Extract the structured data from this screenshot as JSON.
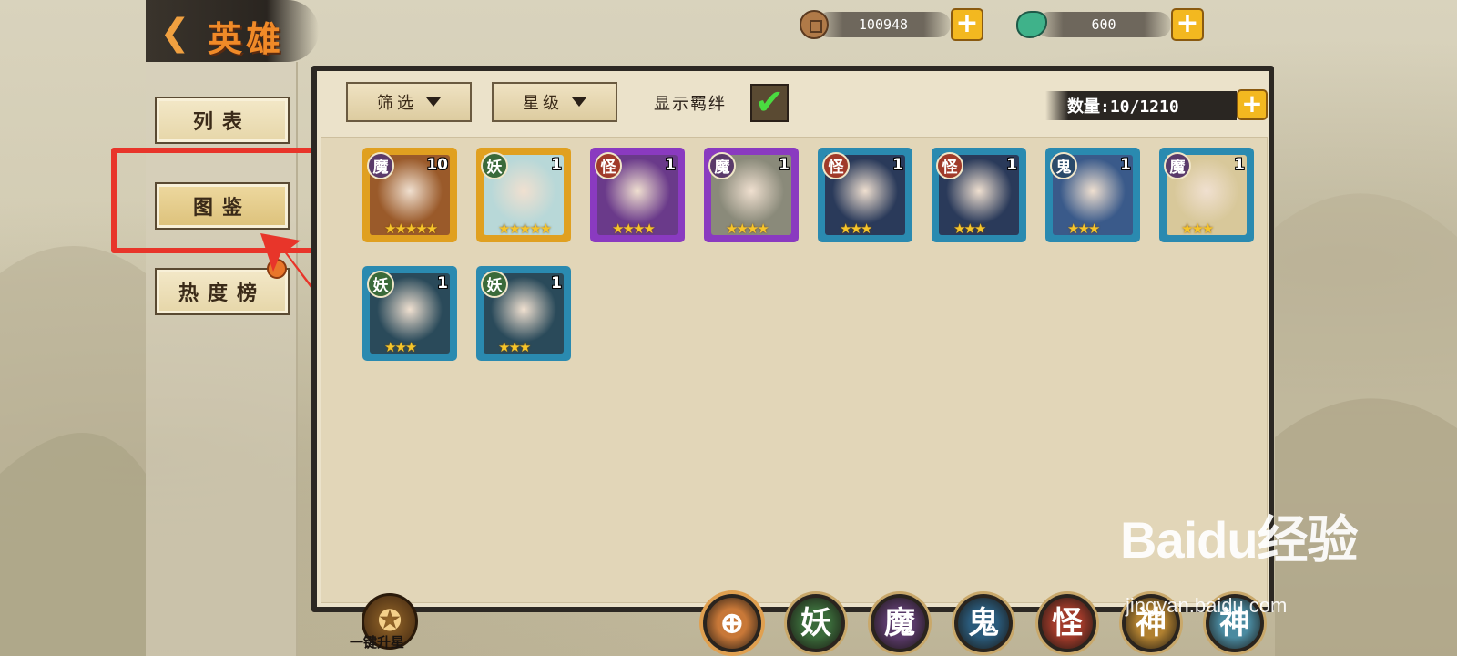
{
  "header": {
    "back_icon": "back-arrow-icon",
    "title": "英雄"
  },
  "currency": [
    {
      "icon": "copper-coin-icon",
      "amount": "100948",
      "add_label": "+"
    },
    {
      "icon": "jade-icon",
      "amount": "600",
      "add_label": "+"
    }
  ],
  "sidebar": {
    "items": [
      {
        "label": "列表"
      },
      {
        "label": "图鉴"
      },
      {
        "label": "热度榜"
      }
    ]
  },
  "toolbar": {
    "filter_label": "筛选",
    "star_label": "星级",
    "show_bond_label": "显示羁绊",
    "show_bond_checked": "✔",
    "count_label": "数量:10/1210",
    "count_add_label": "+"
  },
  "heroes": [
    {
      "faction": "魔",
      "level": "10",
      "stars": "★★★★★",
      "frame": "#e0a020",
      "bg": "#9a5a2a",
      "faction_color": "#5a3a6a"
    },
    {
      "faction": "妖",
      "level": "1",
      "stars": "★★★★★",
      "frame": "#e0a020",
      "bg": "#b8d8d8",
      "faction_color": "#3a6a3a"
    },
    {
      "faction": "怪",
      "level": "1",
      "stars": "★★★★",
      "frame": "#8a3ac0",
      "bg": "#6a3a8a",
      "faction_color": "#a03a2a"
    },
    {
      "faction": "魔",
      "level": "1",
      "stars": "★★★★",
      "frame": "#8a3ac0",
      "bg": "#8a8a7a",
      "faction_color": "#5a3a6a"
    },
    {
      "faction": "怪",
      "level": "1",
      "stars": "★★★",
      "frame": "#2a8ab0",
      "bg": "#2a3a5a",
      "faction_color": "#a03a2a"
    },
    {
      "faction": "怪",
      "level": "1",
      "stars": "★★★",
      "frame": "#2a8ab0",
      "bg": "#2a3a5a",
      "faction_color": "#a03a2a"
    },
    {
      "faction": "鬼",
      "level": "1",
      "stars": "★★★",
      "frame": "#2a8ab0",
      "bg": "#3a5a8a",
      "faction_color": "#2a4a6a"
    },
    {
      "faction": "魔",
      "level": "1",
      "stars": "★★★",
      "frame": "#2a8ab0",
      "bg": "#d8c89a",
      "faction_color": "#5a3a6a"
    },
    {
      "faction": "妖",
      "level": "1",
      "stars": "★★★",
      "frame": "#2a8ab0",
      "bg": "#2a4a5a",
      "faction_color": "#3a6a3a"
    },
    {
      "faction": "妖",
      "level": "1",
      "stars": "★★★",
      "frame": "#2a8ab0",
      "bg": "#2a4a5a",
      "faction_color": "#3a6a3a"
    }
  ],
  "bottom": {
    "star_up_label": "一键升星",
    "star_up_icon": "star-up-icon",
    "filters": [
      {
        "label": "",
        "icon": "all-faction-icon",
        "color": "#c87838"
      },
      {
        "label": "妖",
        "color": "#3a6a3a"
      },
      {
        "label": "魔",
        "color": "#5a3a6a"
      },
      {
        "label": "鬼",
        "color": "#2a5a7a"
      },
      {
        "label": "怪",
        "color": "#a03a2a"
      },
      {
        "label": "神",
        "color": "#b08030"
      },
      {
        "label": "神",
        "color": "#4a8aa0"
      }
    ]
  },
  "watermark": {
    "brand": "Baidu经验",
    "url": "jingyan.baidu.com"
  }
}
